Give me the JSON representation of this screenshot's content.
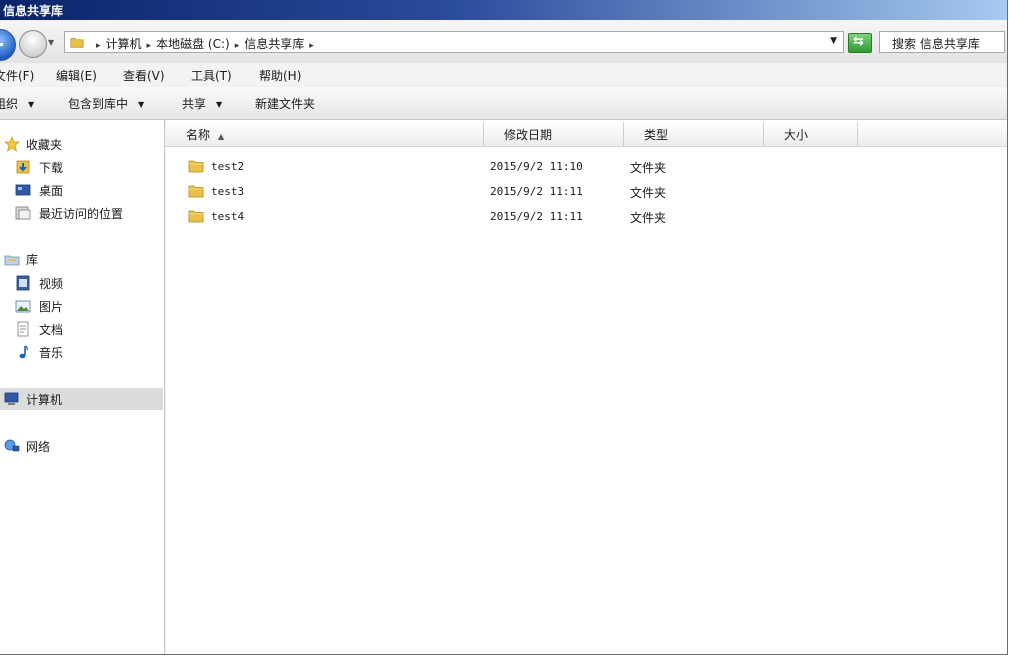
{
  "window": {
    "title": "信息共享库"
  },
  "address": {
    "crumbs": [
      "计算机",
      "本地磁盘 (C:)",
      "信息共享库"
    ],
    "search_placeholder": "搜索 信息共享库"
  },
  "menu": {
    "items": [
      "文件(F)",
      "编辑(E)",
      "查看(V)",
      "工具(T)",
      "帮助(H)"
    ]
  },
  "toolbar": {
    "organize": "组织",
    "include_library": "包含到库中",
    "share": "共享",
    "new_folder": "新建文件夹"
  },
  "sidebar": {
    "favorites": "收藏夹",
    "downloads": "下载",
    "desktop": "桌面",
    "recent": "最近访问的位置",
    "libraries": "库",
    "videos": "视频",
    "pictures": "图片",
    "documents": "文档",
    "music": "音乐",
    "computer": "计算机",
    "network": "网络"
  },
  "columns": {
    "name": "名称",
    "modified": "修改日期",
    "type": "类型",
    "size": "大小"
  },
  "files": [
    {
      "name": "test2",
      "modified": "2015/9/2 11:10",
      "type": "文件夹",
      "size": ""
    },
    {
      "name": "test3",
      "modified": "2015/9/2 11:11",
      "type": "文件夹",
      "size": ""
    },
    {
      "name": "test4",
      "modified": "2015/9/2 11:11",
      "type": "文件夹",
      "size": ""
    }
  ],
  "colors": {
    "title_bar_start": "#0a246a",
    "title_bar_end": "#a6caf0",
    "folder_yellow": "#e8c04a",
    "selection_gray": "#dcdcdc"
  }
}
